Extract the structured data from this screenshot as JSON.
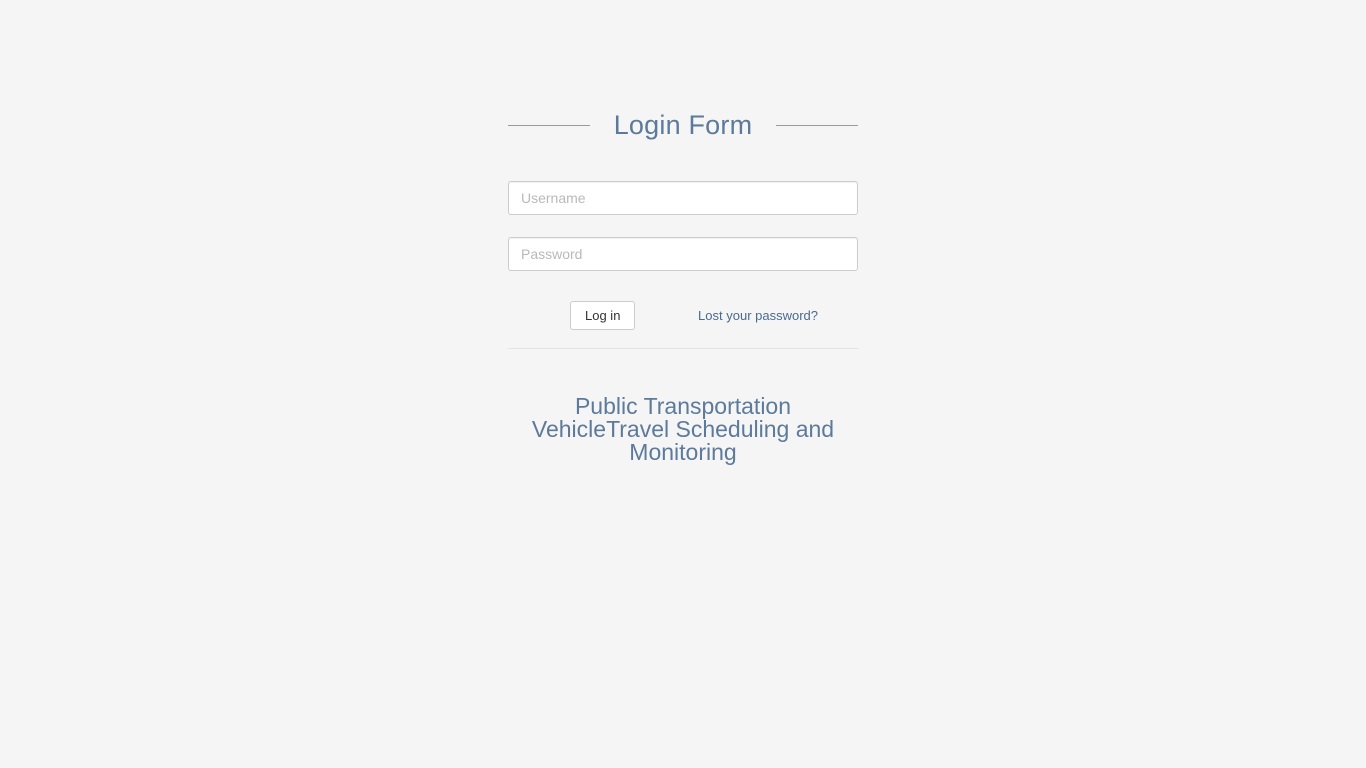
{
  "login": {
    "title": "Login Form",
    "username_placeholder": "Username",
    "password_placeholder": "Password",
    "submit_label": "Log in",
    "lost_password_label": "Lost your password?"
  },
  "subtitle": "Public Transportation VehicleTravel Scheduling and Monitoring"
}
